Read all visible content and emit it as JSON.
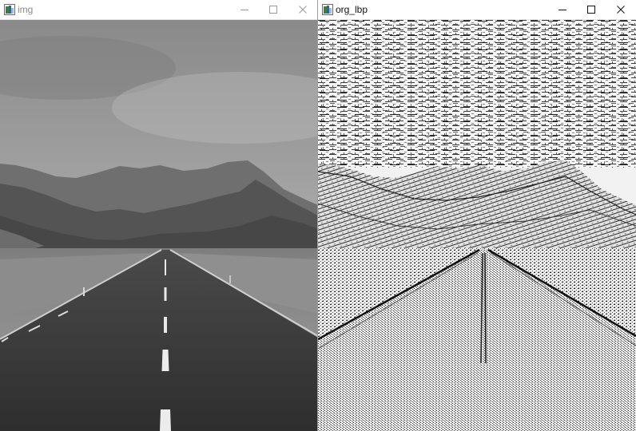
{
  "windows": [
    {
      "title": "img"
    },
    {
      "title": "org_lbp"
    }
  ],
  "colors": {
    "titlebar_bg": "#ffffff",
    "inactive_title": "#8a8a8a",
    "active_title": "#111111"
  },
  "icons": {
    "app": "opencv-window-icon",
    "minimize": "minimize-icon",
    "maximize": "maximize-icon",
    "close": "close-icon"
  }
}
